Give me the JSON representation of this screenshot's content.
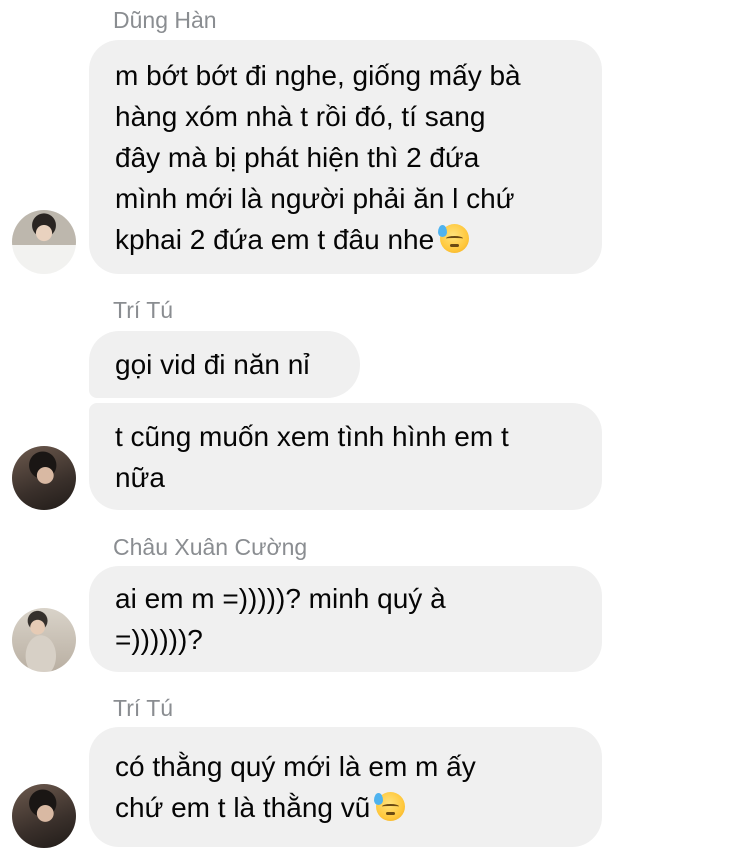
{
  "messages": [
    {
      "sender": "Dũng Hàn",
      "bubbles": [
        {
          "lines": [
            "m bớt bớt đi nghe, giống mấy bà",
            "hàng xóm nhà t rồi đó, tí sang",
            "đây mà bị phát hiện thì 2 đứa",
            "mình mới là người phải ăn l chứ",
            "kphai 2 đứa em t đâu nhe"
          ],
          "emoji": "downcast-face-with-sweat"
        }
      ]
    },
    {
      "sender": "Trí Tú",
      "bubbles": [
        {
          "lines": [
            "gọi vid đi năn nỉ"
          ]
        },
        {
          "lines": [
            "t cũng muốn xem tình hình em t",
            "nữa"
          ]
        }
      ]
    },
    {
      "sender": "Châu Xuân Cường",
      "bubbles": [
        {
          "lines": [
            "ai em m =)))))? minh quý à",
            "=))))))?"
          ]
        }
      ]
    },
    {
      "sender": "Trí Tú",
      "bubbles": [
        {
          "lines": [
            "có thằng quý mới là em m ấy",
            "chứ em t là thằng vũ"
          ],
          "emoji": "downcast-face-with-sweat"
        }
      ]
    }
  ],
  "theme": {
    "bubble_bg": "#f0f0f0",
    "sender_color": "#8a8d91",
    "text_color": "#050505"
  }
}
